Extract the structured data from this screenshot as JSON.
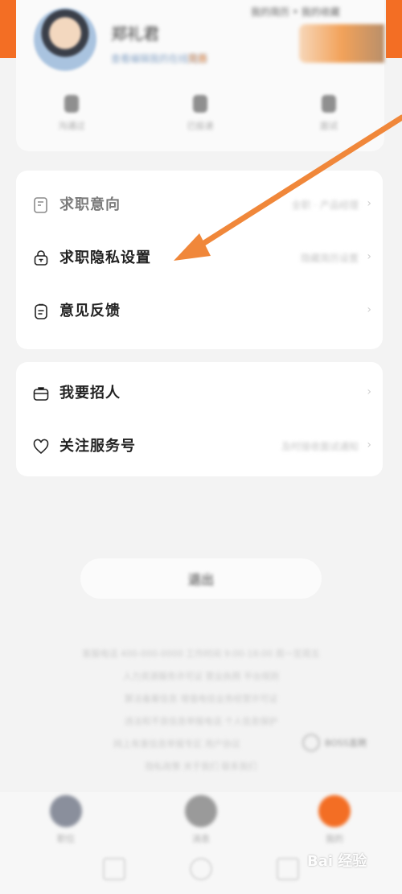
{
  "profile": {
    "name": "郑礼君",
    "subtitle": "查看编辑我的在线简历",
    "tag": "完善",
    "top_stat": "我的简历 • 我的收藏",
    "quick": [
      {
        "label": "沟通过"
      },
      {
        "label": "已投递"
      },
      {
        "label": "面试"
      }
    ]
  },
  "menu_group_1": [
    {
      "label": "求职意向",
      "value": "全职 · 产品经理"
    },
    {
      "label": "求职隐私设置",
      "value": "隐藏简历设置"
    },
    {
      "label": "意见反馈",
      "value": ""
    }
  ],
  "menu_group_2": [
    {
      "label": "我要招人",
      "value": ""
    },
    {
      "label": "关注服务号",
      "value": "及时接收面试通知"
    }
  ],
  "logout_label": "退出",
  "footer_lines": [
    "客服电话 400-000-0000 工作时间 9:00-18:00 周一至周五",
    "人力资源服务许可证 营业执照 平台规则",
    "算法备案信息 增值电信业务经营许可证",
    "违法和不良信息举报电话 个人信息保护",
    "网上有害信息举报专区 用户协议",
    "隐私政策 关于我们 联系我们"
  ],
  "footer_badge": "BOSS直聘",
  "tabs": [
    {
      "label": "职位"
    },
    {
      "label": "消息"
    },
    {
      "label": "我的"
    }
  ],
  "watermark": "Bai 经验",
  "colors": {
    "accent": "#f36e24",
    "arrow": "#f0873a"
  }
}
